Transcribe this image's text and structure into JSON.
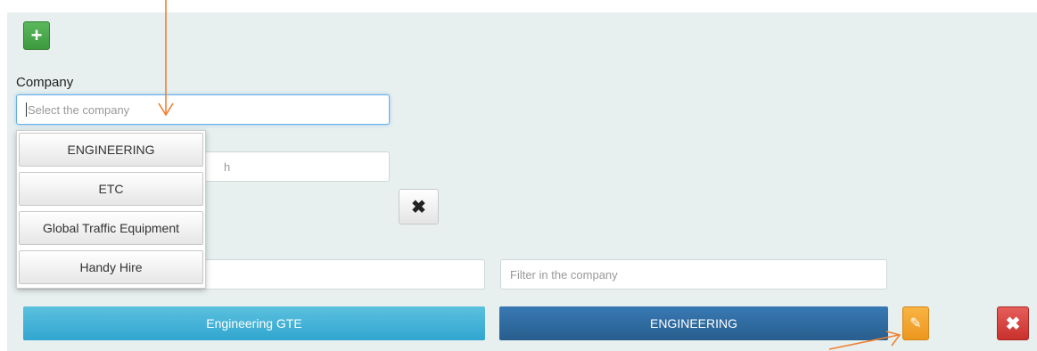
{
  "toolbar": {
    "add_icon": "plus-icon",
    "add_glyph": "+"
  },
  "company": {
    "label": "Company",
    "placeholder": "Select the company",
    "options": [
      "ENGINEERING",
      "ETC",
      "Global Traffic Equipment",
      "Handy Hire"
    ]
  },
  "second_field": {
    "visible_fragment": "h"
  },
  "clear_button": {
    "icon": "close-icon",
    "glyph": "✖"
  },
  "filter": {
    "placeholder": "Filter in the company"
  },
  "row": {
    "name": "Engineering GTE",
    "company": "ENGINEERING",
    "edit_icon": "edit-icon",
    "edit_glyph": "✎",
    "delete_icon": "close-icon",
    "delete_glyph": "✖"
  },
  "colors": {
    "panel_bg": "#e7efef",
    "success": "#5cb85c",
    "info": "#5bc0de",
    "primary": "#337ab7",
    "warning": "#f0ad4e",
    "danger": "#d9534f",
    "annotation_arrow": "#f08030"
  }
}
